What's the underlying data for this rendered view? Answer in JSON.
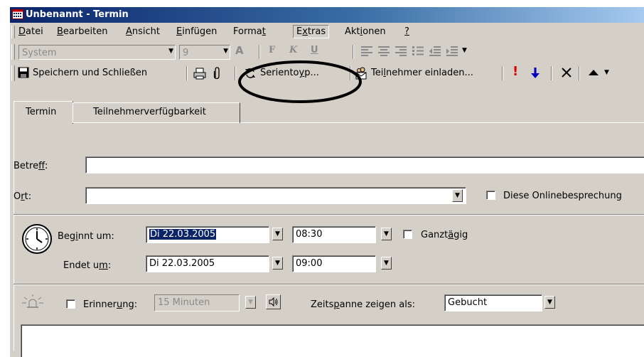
{
  "window": {
    "title": "Unbenannt - Termin"
  },
  "menu": [
    {
      "label": "Datei"
    },
    {
      "label": "Bearbeiten"
    },
    {
      "label": "Ansicht"
    },
    {
      "label": "Einfügen"
    },
    {
      "label": "Format"
    },
    {
      "label": "Extras"
    },
    {
      "label": "Aktionen"
    },
    {
      "label": "?"
    }
  ],
  "format_toolbar": {
    "font": "System",
    "size": "9",
    "buttons": [
      "font-color",
      "bold",
      "italic",
      "underline",
      "align-left",
      "center",
      "align-right",
      "bullets",
      "decrease-indent",
      "increase-indent",
      "toolbar-options"
    ]
  },
  "standard_toolbar": {
    "save_close": "Speichern und Schließen",
    "recurrence": "Serientyp...",
    "invite": "Teilnehmer einladen...",
    "icons": [
      "save-icon",
      "print-icon",
      "attach-icon",
      "recurrence-icon",
      "invite-icon",
      "high-importance-icon",
      "low-importance-icon",
      "delete-icon",
      "previous-item-icon"
    ]
  },
  "tabs": [
    {
      "label": "Termin",
      "active": true
    },
    {
      "label": "Teilnehmerverfügbarkeit",
      "active": false
    }
  ],
  "form": {
    "subject_label": "Betreff:",
    "subject_value": "",
    "location_label": "Ort:",
    "location_value": "",
    "online_meeting_label": "Diese Onlinebesprechung",
    "start_label": "Beginnt um:",
    "start_date": "Di 22.03.2005",
    "start_time": "08:30",
    "all_day_label": "Ganztägig",
    "end_label": "Endet um:",
    "end_date": "Di 22.03.2005",
    "end_time": "09:00",
    "reminder_label": "Erinnerung:",
    "reminder_value": "15 Minuten",
    "show_as_label": "Zeitspanne zeigen als:",
    "show_as_value": "Gebucht"
  },
  "annotation": {
    "highlighted": "recurrence-button"
  },
  "colors": {
    "face": "#d4d0c8",
    "title_start": "#0a246a",
    "title_end": "#a6caf0",
    "selection": "#0a246a",
    "importance_high": "#e00000",
    "importance_low": "#0000c0"
  }
}
